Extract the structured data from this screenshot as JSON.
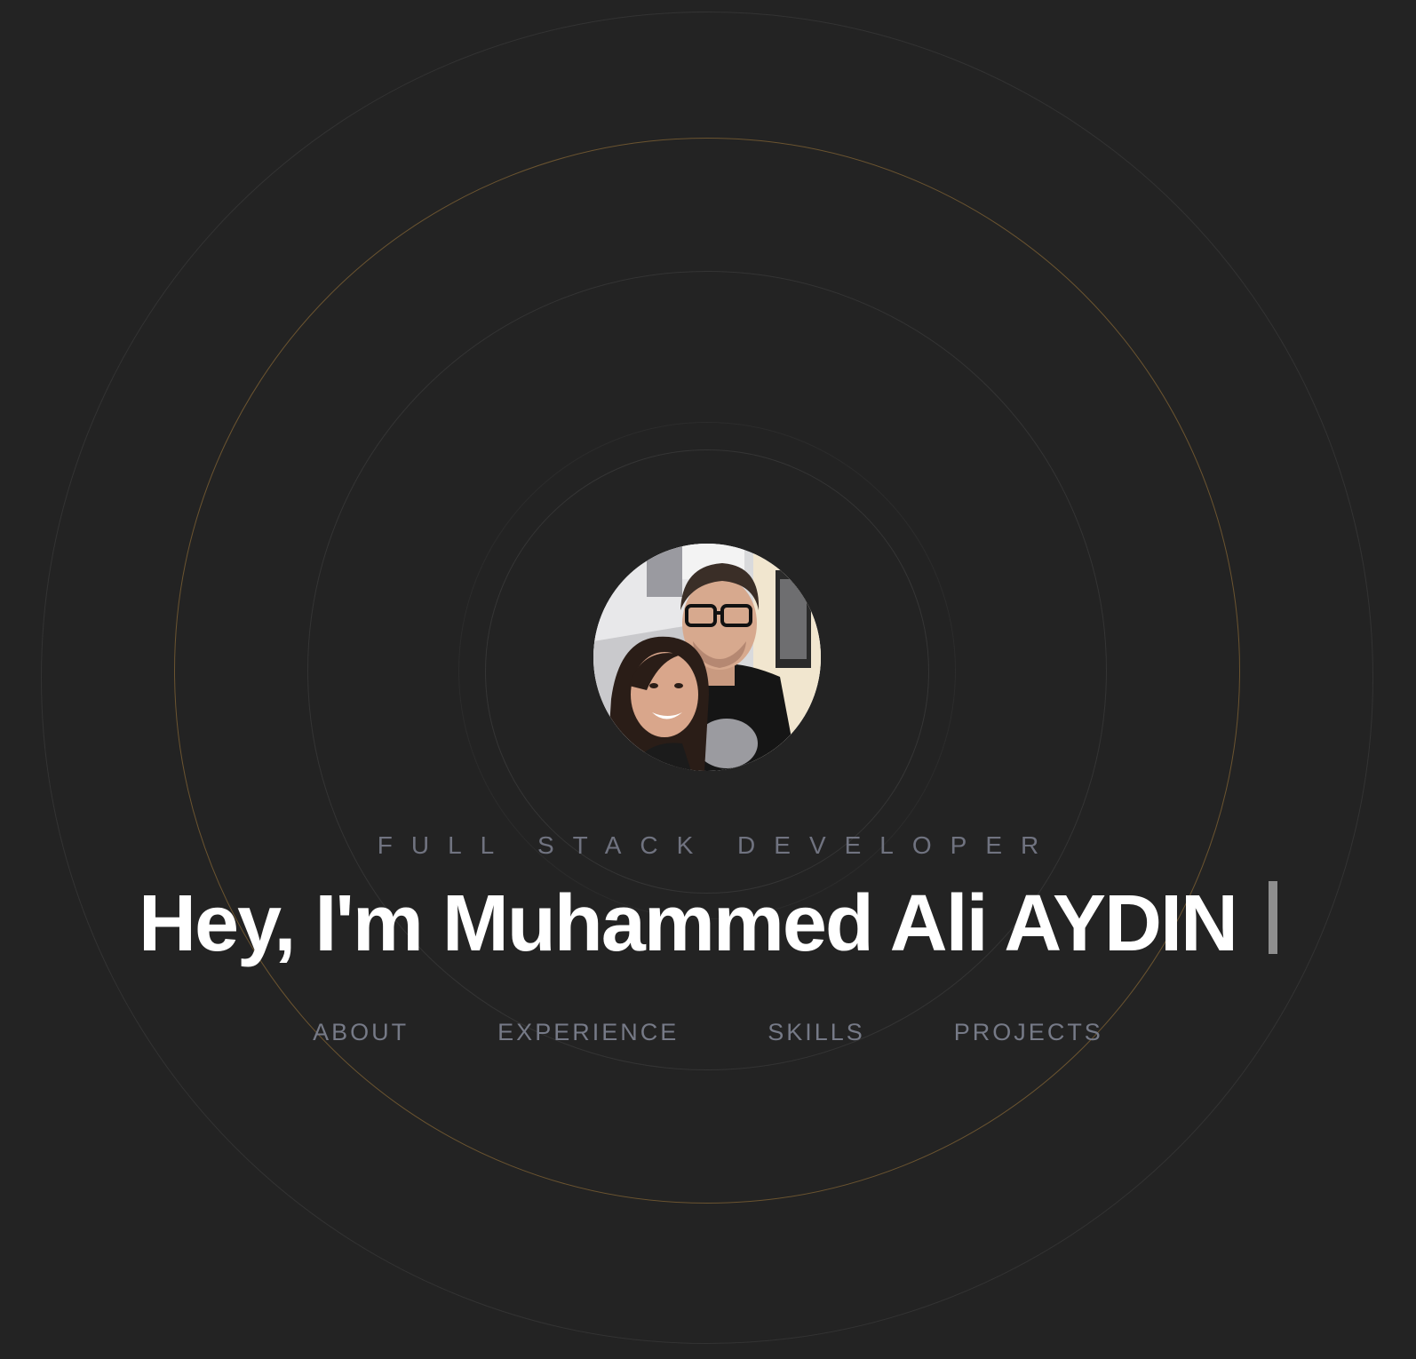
{
  "hero": {
    "role": "FULL STACK DEVELOPER",
    "headline": "Hey, I'm Muhammed Ali AYDIN",
    "avatar_alt": "Profile photo"
  },
  "nav": {
    "items": [
      {
        "label": "ABOUT"
      },
      {
        "label": "EXPERIENCE"
      },
      {
        "label": "SKILLS"
      },
      {
        "label": "PROJECTS"
      }
    ]
  },
  "colors": {
    "background": "#232323",
    "accent_ring": "#6b5430",
    "headline": "#ffffff",
    "muted_text": "#767a87"
  }
}
